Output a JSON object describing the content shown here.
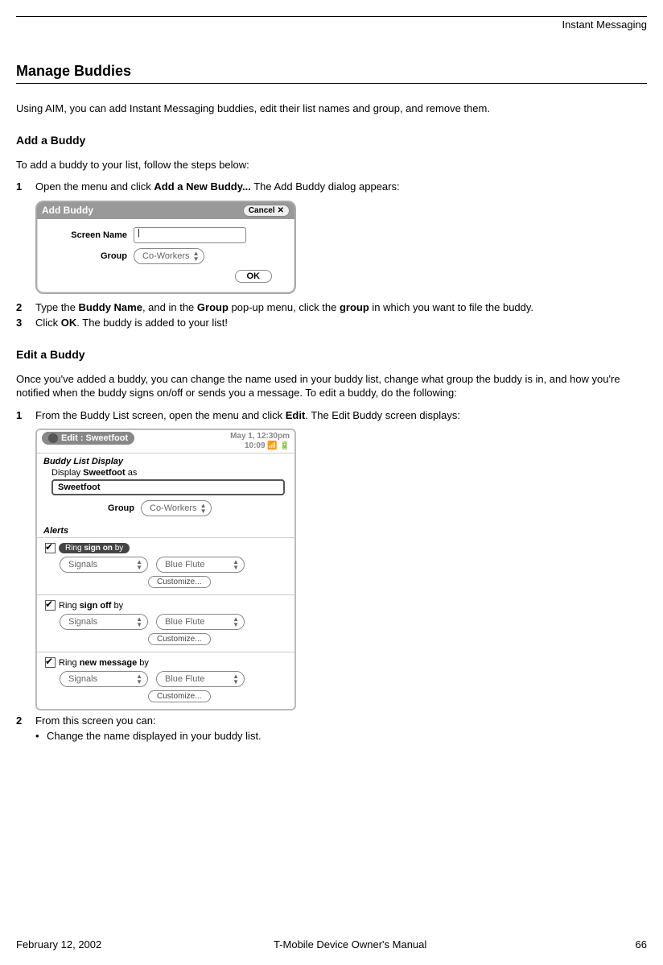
{
  "running_header": "Instant Messaging",
  "section_title": "Manage Buddies",
  "intro": "Using AIM, you can add Instant Messaging buddies, edit their list names and group, and remove them.",
  "add": {
    "heading": "Add a Buddy",
    "lead": "To add a buddy to your list, follow the steps below:",
    "step1_a": "Open the menu and click ",
    "step1_b": "Add a New Buddy...",
    "step1_c": " The Add Buddy dialog appears:",
    "dialog": {
      "title": "Add Buddy",
      "cancel": "Cancel",
      "close_glyph": "✕",
      "screen_name_label": "Screen Name",
      "screen_name_value": "|",
      "group_label": "Group",
      "group_value": "Co-Workers",
      "ok": "OK"
    },
    "step2_a": "Type the ",
    "step2_b": "Buddy Name",
    "step2_c": ", and in the ",
    "step2_d": "Group",
    "step2_e": " pop-up menu, click the ",
    "step2_f": "group",
    "step2_g": " in which you want to file the buddy.",
    "step3_a": "Click ",
    "step3_b": "OK",
    "step3_c": ". The buddy is added to your list!"
  },
  "edit": {
    "heading": "Edit a Buddy",
    "lead": "Once you've added a buddy, you can change the name used in your buddy list, change what group the buddy is in, and how you're notified when the buddy signs on/off or sends you a message. To edit a buddy, do the following:",
    "step1_a": "From the Buddy List screen, open the menu and click ",
    "step1_b": "Edit",
    "step1_c": ". The Edit Buddy screen displays:",
    "screen": {
      "chip": "Edit : Sweetfoot",
      "date": "May 1, 12:30pm",
      "time": "10:09",
      "section_display": "Buddy List Display",
      "display_line_a": "Display ",
      "display_line_b": "Sweetfoot",
      "display_line_c": " as",
      "name_value": "Sweetfoot",
      "group_label": "Group",
      "group_value": "Co-Workers",
      "section_alerts": "Alerts",
      "alerts": [
        {
          "prefix": "Ring ",
          "bold": "sign on",
          "suffix": " by",
          "highlighted": true
        },
        {
          "prefix": "Ring ",
          "bold": "sign off",
          "suffix": " by",
          "highlighted": false
        },
        {
          "prefix": "Ring ",
          "bold": "new message",
          "suffix": " by",
          "highlighted": false
        }
      ],
      "signals": "Signals",
      "tone": "Blue Flute",
      "customize": "Customize..."
    },
    "step2": "From this screen you can:",
    "bullet1": "Change the name displayed in your buddy list."
  },
  "footer": {
    "date": "February 12, 2002",
    "center": "T-Mobile Device Owner's Manual",
    "page": "66"
  }
}
